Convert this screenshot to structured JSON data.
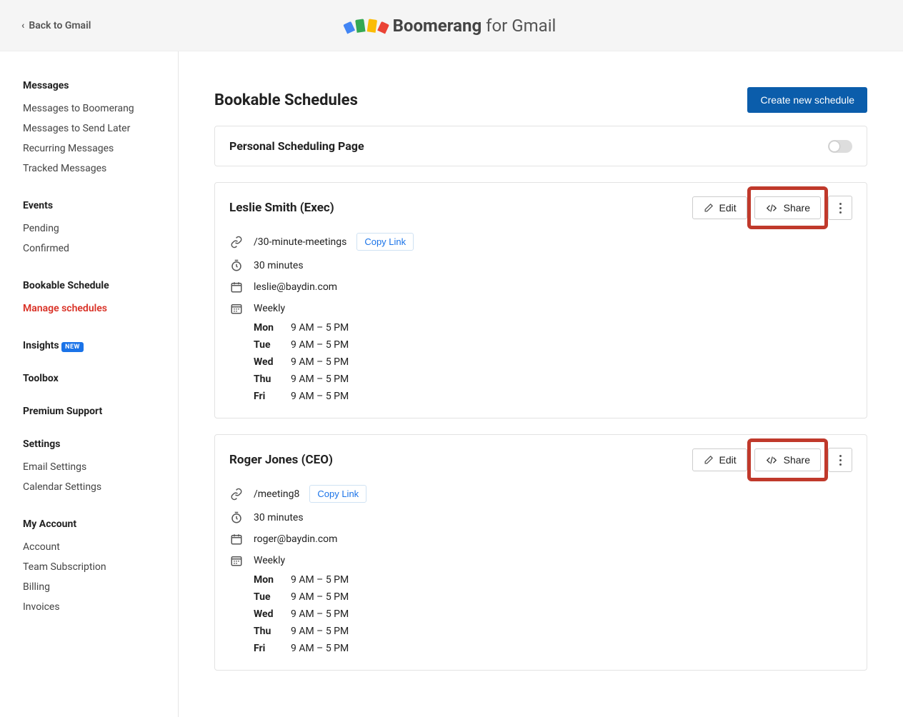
{
  "header": {
    "back_label": "Back to Gmail",
    "brand_strong": "Boomerang",
    "brand_rest": " for Gmail"
  },
  "sidebar": {
    "groups": [
      {
        "head": "Messages",
        "items": [
          "Messages to Boomerang",
          "Messages to Send Later",
          "Recurring Messages",
          "Tracked Messages"
        ]
      },
      {
        "head": "Events",
        "items": [
          "Pending",
          "Confirmed"
        ]
      },
      {
        "head": "Bookable Schedule",
        "items": [
          "Manage schedules"
        ],
        "active_index": 0
      },
      {
        "head": "Insights",
        "badge": "NEW",
        "items": []
      },
      {
        "head": "Toolbox",
        "items": []
      },
      {
        "head": "Premium Support",
        "items": []
      },
      {
        "head": "Settings",
        "items": [
          "Email Settings",
          "Calendar Settings"
        ]
      },
      {
        "head": "My Account",
        "items": [
          "Account",
          "Team Subscription",
          "Billing",
          "Invoices"
        ]
      }
    ]
  },
  "page": {
    "title": "Bookable Schedules",
    "create_label": "Create new schedule",
    "personal_card_title": "Personal Scheduling Page",
    "edit_label": "Edit",
    "share_label": "Share",
    "copy_link_label": "Copy Link",
    "weekly_label": "Weekly",
    "schedules": [
      {
        "title": "Leslie Smith (Exec)",
        "slug": "/30-minute-meetings",
        "duration": "30 minutes",
        "email": "leslie@baydin.com",
        "rows": [
          {
            "day": "Mon",
            "hours": "9 AM – 5 PM"
          },
          {
            "day": "Tue",
            "hours": "9 AM – 5 PM"
          },
          {
            "day": "Wed",
            "hours": "9 AM – 5 PM"
          },
          {
            "day": "Thu",
            "hours": "9 AM – 5 PM"
          },
          {
            "day": "Fri",
            "hours": "9 AM – 5 PM"
          }
        ]
      },
      {
        "title": "Roger Jones (CEO)",
        "slug": "/meeting8",
        "duration": "30 minutes",
        "email": "roger@baydin.com",
        "rows": [
          {
            "day": "Mon",
            "hours": "9 AM – 5 PM"
          },
          {
            "day": "Tue",
            "hours": "9 AM – 5 PM"
          },
          {
            "day": "Wed",
            "hours": "9 AM – 5 PM"
          },
          {
            "day": "Thu",
            "hours": "9 AM – 5 PM"
          },
          {
            "day": "Fri",
            "hours": "9 AM – 5 PM"
          }
        ]
      }
    ]
  }
}
